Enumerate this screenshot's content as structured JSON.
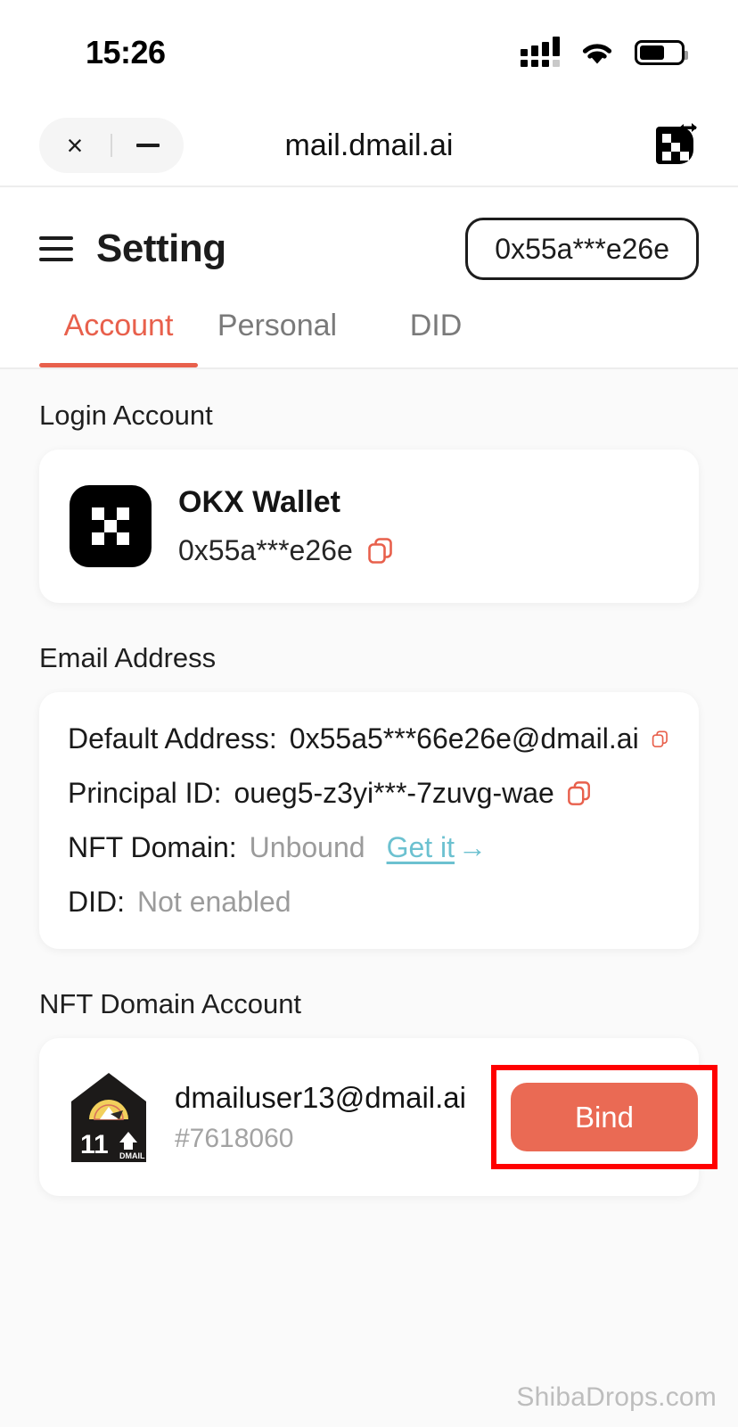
{
  "status_bar": {
    "time": "15:26",
    "signal_icon": "cellular-signal-icon",
    "wifi_icon": "wifi-icon",
    "battery_icon": "battery-icon"
  },
  "browser_bar": {
    "close_label": "×",
    "minimize_label": "—",
    "url": "mail.dmail.ai",
    "brand_icon": "okx-swap-icon"
  },
  "app_header": {
    "menu_icon": "hamburger-menu-icon",
    "title": "Setting",
    "wallet_pill": "0x55a***e26e"
  },
  "tabs": [
    {
      "label": "Account",
      "active": true
    },
    {
      "label": "Personal",
      "active": false
    },
    {
      "label": "DID",
      "active": false
    }
  ],
  "login_account": {
    "section_label": "Login Account",
    "wallet_logo_icon": "okx-wallet-logo-icon",
    "wallet_name": "OKX Wallet",
    "wallet_address": "0x55a***e26e",
    "copy_icon": "copy-icon"
  },
  "email_address": {
    "section_label": "Email Address",
    "rows": [
      {
        "key": "Default Address:",
        "value": "0x55a5***66e26e@dmail.ai",
        "copyable": true
      },
      {
        "key": "Principal ID:",
        "value": "oueg5-z3yi***-7zuvg-wae",
        "copyable": true
      },
      {
        "key": "NFT Domain:",
        "value": "Unbound",
        "link": "Get it",
        "link_arrow": "→"
      },
      {
        "key": "DID:",
        "value": "Not enabled"
      }
    ]
  },
  "nft_domain_account": {
    "section_label": "NFT Domain Account",
    "thumbnail_icon": "dmail-nft-badge-icon",
    "nft_number": "11",
    "nft_brand": "DMAIL",
    "email": "dmailuser13@dmail.ai",
    "token_id": "#7618060",
    "bind_button": "Bind"
  },
  "watermark": "ShibaDrops.com",
  "colors": {
    "accent": "#e8604c",
    "bind_button": "#ea6a54",
    "link": "#6cc1d0",
    "highlight_box": "#ff0000",
    "muted_text": "#9b9b9b",
    "page_background": "#fafafa"
  }
}
